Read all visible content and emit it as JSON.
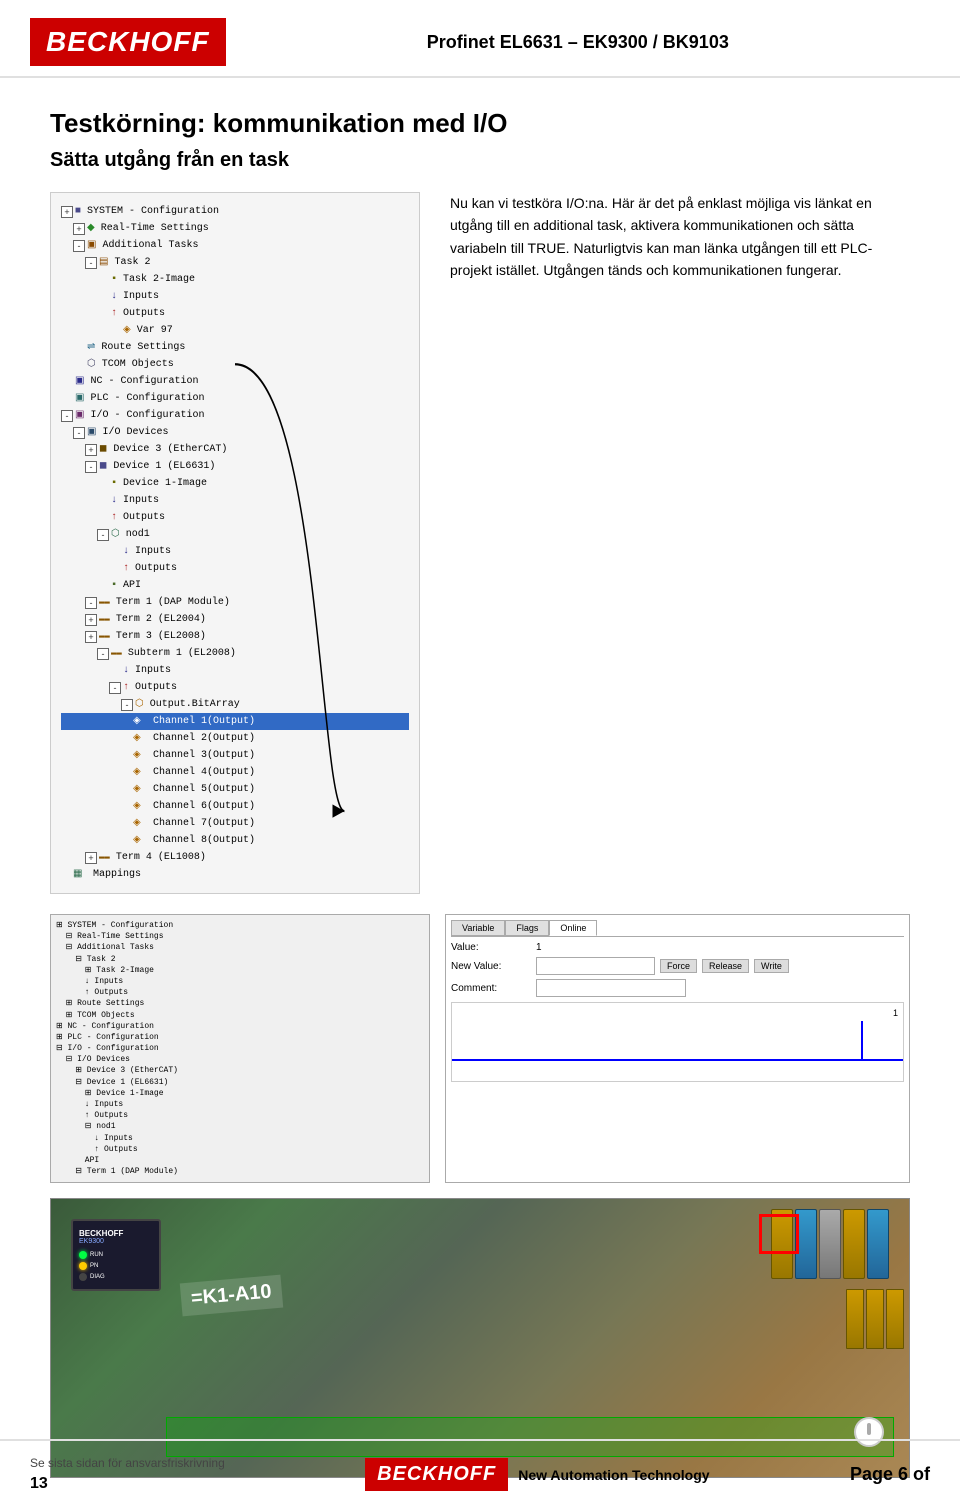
{
  "header": {
    "logo": "BECKHOFF",
    "title": "Profinet EL6631 – EK9300 / BK9103",
    "logo_bg": "#CC0000"
  },
  "section": {
    "main_title": "Testkörning: kommunikation med I/O",
    "subtitle": "Sätta utgång från en task"
  },
  "description": {
    "para1": "Nu kan vi testköra I/O:na. Här är det på enklast möjliga vis länkat en utgång till en additional task, aktivera kommunikationen och sätta variabeln till TRUE. Naturligtvis kan man länka utgången till ett PLC-projekt istället. Utgången tänds och kommunikationen fungerar."
  },
  "tree": {
    "items": [
      {
        "indent": 0,
        "expand": "+",
        "icon": "sys",
        "label": "SYSTEM - Configuration"
      },
      {
        "indent": 1,
        "expand": "+",
        "icon": "rt",
        "label": "Real-Time Settings"
      },
      {
        "indent": 1,
        "expand": "-",
        "icon": "tasks",
        "label": "Additional Tasks"
      },
      {
        "indent": 2,
        "expand": "-",
        "icon": "task",
        "label": "Task 2"
      },
      {
        "indent": 3,
        "expand": null,
        "icon": "img",
        "label": "Task 2-Image"
      },
      {
        "indent": 3,
        "expand": null,
        "icon": "in",
        "label": "Inputs"
      },
      {
        "indent": 3,
        "expand": null,
        "icon": "out",
        "label": "Outputs"
      },
      {
        "indent": 4,
        "expand": null,
        "icon": "var",
        "label": "Var 97",
        "selected": false
      },
      {
        "indent": 1,
        "expand": null,
        "icon": "route",
        "label": "Route Settings"
      },
      {
        "indent": 1,
        "expand": null,
        "icon": "tcom",
        "label": "TCOM Objects"
      },
      {
        "indent": 0,
        "expand": null,
        "icon": "nc",
        "label": "NC - Configuration"
      },
      {
        "indent": 0,
        "expand": null,
        "icon": "plc",
        "label": "PLC - Configuration"
      },
      {
        "indent": 0,
        "expand": "-",
        "icon": "io",
        "label": "I/O - Configuration"
      },
      {
        "indent": 1,
        "expand": "-",
        "icon": "iodev",
        "label": "I/O Devices"
      },
      {
        "indent": 2,
        "expand": "+",
        "icon": "dev3",
        "label": "Device 3 (EtherCAT)"
      },
      {
        "indent": 2,
        "expand": "-",
        "icon": "dev1",
        "label": "Device 1 (EL6631)"
      },
      {
        "indent": 3,
        "expand": null,
        "icon": "img",
        "label": "Device 1-Image"
      },
      {
        "indent": 3,
        "expand": null,
        "icon": "in",
        "label": "Inputs"
      },
      {
        "indent": 3,
        "expand": "-",
        "icon": "out",
        "label": "Outputs"
      },
      {
        "indent": 3,
        "expand": "-",
        "icon": "nod",
        "label": "nod1"
      },
      {
        "indent": 4,
        "expand": null,
        "icon": "in",
        "label": "Inputs"
      },
      {
        "indent": 4,
        "expand": null,
        "icon": "out",
        "label": "Outputs"
      },
      {
        "indent": 3,
        "expand": null,
        "icon": "api",
        "label": "API"
      },
      {
        "indent": 2,
        "expand": "-",
        "icon": "box",
        "label": "Term 1 (DAP Module)"
      },
      {
        "indent": 2,
        "expand": "+",
        "icon": "box2",
        "label": "Term 2 (EL2004)"
      },
      {
        "indent": 2,
        "expand": "+",
        "icon": "box3",
        "label": "Term 3 (EL2008)"
      },
      {
        "indent": 3,
        "expand": "-",
        "icon": "sub",
        "label": "Subterm 1 (EL2008)"
      },
      {
        "indent": 4,
        "expand": null,
        "icon": "in",
        "label": "Inputs"
      },
      {
        "indent": 4,
        "expand": "-",
        "icon": "out",
        "label": "Outputs"
      },
      {
        "indent": 5,
        "expand": "-",
        "icon": "bitarr",
        "label": "Output.BitArray"
      },
      {
        "indent": 6,
        "expand": null,
        "icon": "ch",
        "label": "Channel 1(Output)",
        "selected": true
      },
      {
        "indent": 6,
        "expand": null,
        "icon": "ch",
        "label": "Channel 2(Output)"
      },
      {
        "indent": 6,
        "expand": null,
        "icon": "ch",
        "label": "Channel 3(Output)"
      },
      {
        "indent": 6,
        "expand": null,
        "icon": "ch",
        "label": "Channel 4(Output)"
      },
      {
        "indent": 6,
        "expand": null,
        "icon": "ch",
        "label": "Channel 5(Output)"
      },
      {
        "indent": 6,
        "expand": null,
        "icon": "ch",
        "label": "Channel 6(Output)"
      },
      {
        "indent": 6,
        "expand": null,
        "icon": "ch",
        "label": "Channel 7(Output)"
      },
      {
        "indent": 6,
        "expand": null,
        "icon": "ch",
        "label": "Channel 8(Output)"
      },
      {
        "indent": 2,
        "expand": "+",
        "icon": "box4",
        "label": "Term 4 (EL1008)"
      },
      {
        "indent": 1,
        "expand": null,
        "icon": "map",
        "label": "Mappings"
      }
    ]
  },
  "variable_panel": {
    "tabs": [
      "Variable",
      "Flags",
      "Online"
    ],
    "active_tab": "Online",
    "fields": [
      {
        "label": "Value:",
        "value": "1"
      },
      {
        "label": "New Value:",
        "value": ""
      },
      {
        "label": "Comment:",
        "value": ""
      }
    ],
    "buttons": [
      "Force",
      "Release",
      "Write"
    ]
  },
  "footer": {
    "disclaimer": "Se sista sidan för ansvarsfriskrivning",
    "number": "13",
    "logo": "BECKHOFF",
    "tagline": "New Automation Technology",
    "page": "Page 6 of"
  }
}
